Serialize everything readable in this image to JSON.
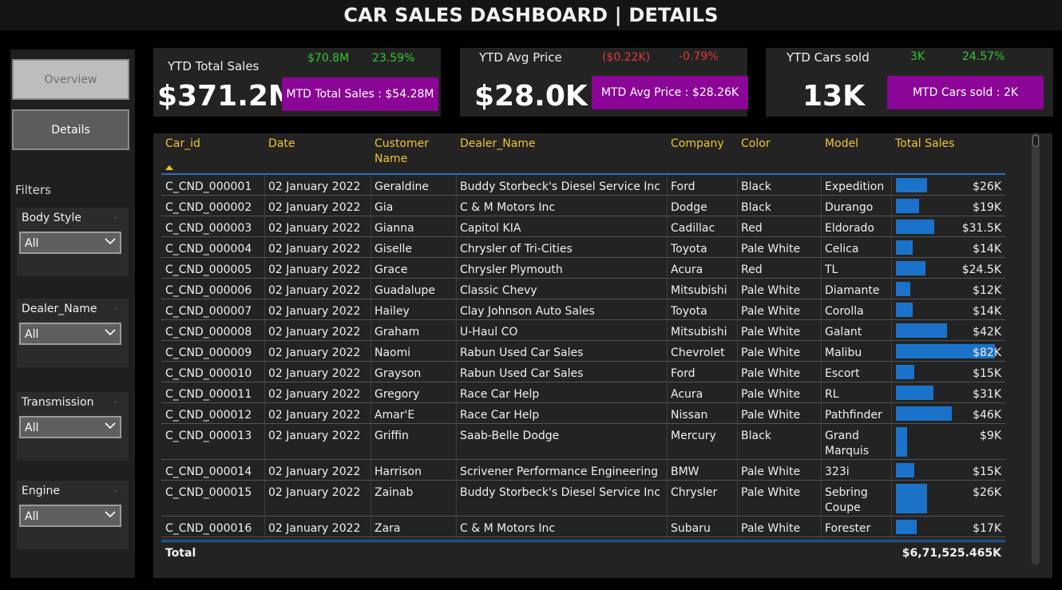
{
  "title": "CAR SALES DASHBOARD | DETAILS",
  "nav": {
    "overview": "Overview",
    "details": "Details"
  },
  "filters": {
    "label": "Filters",
    "slicers": [
      {
        "label": "Body Style",
        "value": "All"
      },
      {
        "label": "Dealer_Name",
        "value": "All"
      },
      {
        "label": "Transmission",
        "value": "All"
      },
      {
        "label": "Engine",
        "value": "All"
      }
    ]
  },
  "kpis": {
    "total_sales": {
      "title": "YTD Total Sales",
      "value": "$371.2M",
      "delta_abs": "$70.8M",
      "delta_pct": "23.59%",
      "mtd": "MTD Total Sales : $54.28M"
    },
    "avg_price": {
      "title": "YTD Avg Price",
      "value": "$28.0K",
      "delta_abs": "($0.22K)",
      "delta_pct": "-0.79%",
      "mtd": "MTD Avg Price : $28.26K"
    },
    "cars_sold": {
      "title": "YTD Cars sold",
      "value": "13K",
      "delta_abs": "3K",
      "delta_pct": "24.57%",
      "mtd": "MTD Cars sold : 2K"
    }
  },
  "colors": {
    "accent_purple": "#8b0596",
    "positive": "#2fc92f",
    "negative": "#e23a3a",
    "header_yellow": "#f0c62c",
    "bar_blue": "#1b73c9"
  },
  "table": {
    "columns": [
      "Car_id",
      "Date",
      "Customer Name",
      "Dealer_Name",
      "Company",
      "Color",
      "Model",
      "Total Sales"
    ],
    "rows": [
      {
        "car_id": "C_CND_000001",
        "date": "02 January 2022",
        "customer": "Geraldine",
        "dealer": "Buddy Storbeck's Diesel Service Inc",
        "company": "Ford",
        "color": "Black",
        "model": "Expedition",
        "sales_label": "$26K",
        "sales": 26
      },
      {
        "car_id": "C_CND_000002",
        "date": "02 January 2022",
        "customer": "Gia",
        "dealer": "C & M Motors Inc",
        "company": "Dodge",
        "color": "Black",
        "model": "Durango",
        "sales_label": "$19K",
        "sales": 19
      },
      {
        "car_id": "C_CND_000003",
        "date": "02 January 2022",
        "customer": "Gianna",
        "dealer": "Capitol KIA",
        "company": "Cadillac",
        "color": "Red",
        "model": "Eldorado",
        "sales_label": "$31.5K",
        "sales": 31.5
      },
      {
        "car_id": "C_CND_000004",
        "date": "02 January 2022",
        "customer": "Giselle",
        "dealer": "Chrysler of Tri-Cities",
        "company": "Toyota",
        "color": "Pale White",
        "model": "Celica",
        "sales_label": "$14K",
        "sales": 14
      },
      {
        "car_id": "C_CND_000005",
        "date": "02 January 2022",
        "customer": "Grace",
        "dealer": "Chrysler Plymouth",
        "company": "Acura",
        "color": "Red",
        "model": "TL",
        "sales_label": "$24.5K",
        "sales": 24.5
      },
      {
        "car_id": "C_CND_000006",
        "date": "02 January 2022",
        "customer": "Guadalupe",
        "dealer": "Classic Chevy",
        "company": "Mitsubishi",
        "color": "Pale White",
        "model": "Diamante",
        "sales_label": "$12K",
        "sales": 12
      },
      {
        "car_id": "C_CND_000007",
        "date": "02 January 2022",
        "customer": "Hailey",
        "dealer": "Clay Johnson Auto Sales",
        "company": "Toyota",
        "color": "Pale White",
        "model": "Corolla",
        "sales_label": "$14K",
        "sales": 14
      },
      {
        "car_id": "C_CND_000008",
        "date": "02 January 2022",
        "customer": "Graham",
        "dealer": "U-Haul CO",
        "company": "Mitsubishi",
        "color": "Pale White",
        "model": "Galant",
        "sales_label": "$42K",
        "sales": 42
      },
      {
        "car_id": "C_CND_000009",
        "date": "02 January 2022",
        "customer": "Naomi",
        "dealer": "Rabun Used Car Sales",
        "company": "Chevrolet",
        "color": "Pale White",
        "model": "Malibu",
        "sales_label": "$82K",
        "sales": 82
      },
      {
        "car_id": "C_CND_000010",
        "date": "02 January 2022",
        "customer": "Grayson",
        "dealer": "Rabun Used Car Sales",
        "company": "Ford",
        "color": "Pale White",
        "model": "Escort",
        "sales_label": "$15K",
        "sales": 15
      },
      {
        "car_id": "C_CND_000011",
        "date": "02 January 2022",
        "customer": "Gregory",
        "dealer": "Race Car Help",
        "company": "Acura",
        "color": "Pale White",
        "model": "RL",
        "sales_label": "$31K",
        "sales": 31
      },
      {
        "car_id": "C_CND_000012",
        "date": "02 January 2022",
        "customer": "Amar'E",
        "dealer": "Race Car Help",
        "company": "Nissan",
        "color": "Pale White",
        "model": "Pathfinder",
        "sales_label": "$46K",
        "sales": 46
      },
      {
        "car_id": "C_CND_000013",
        "date": "02 January 2022",
        "customer": "Griffin",
        "dealer": "Saab-Belle Dodge",
        "company": "Mercury",
        "color": "Black",
        "model": "Grand Marquis",
        "sales_label": "$9K",
        "sales": 9
      },
      {
        "car_id": "C_CND_000014",
        "date": "02 January 2022",
        "customer": "Harrison",
        "dealer": "Scrivener Performance Engineering",
        "company": "BMW",
        "color": "Pale White",
        "model": "323i",
        "sales_label": "$15K",
        "sales": 15
      },
      {
        "car_id": "C_CND_000015",
        "date": "02 January 2022",
        "customer": "Zainab",
        "dealer": "Buddy Storbeck's Diesel Service Inc",
        "company": "Chrysler",
        "color": "Pale White",
        "model": "Sebring Coupe",
        "sales_label": "$26K",
        "sales": 26
      },
      {
        "car_id": "C_CND_000016",
        "date": "02 January 2022",
        "customer": "Zara",
        "dealer": "C & M Motors Inc",
        "company": "Subaru",
        "color": "Pale White",
        "model": "Forester",
        "sales_label": "$17K",
        "sales": 17
      }
    ],
    "total_label": "Total",
    "total_value": "$6,71,525.465K"
  }
}
